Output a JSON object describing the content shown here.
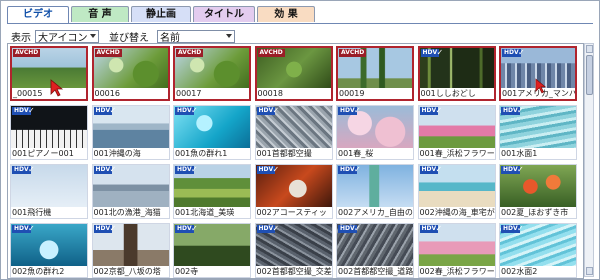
{
  "tabs": [
    {
      "label": "ビデオ",
      "active": true
    },
    {
      "label": "音 声",
      "active": false
    },
    {
      "label": "静止画",
      "active": false
    },
    {
      "label": "タイトル",
      "active": false
    },
    {
      "label": "効 果",
      "active": false
    }
  ],
  "toolbar": {
    "display_label": "表示",
    "display_value": "大アイコン",
    "sort_label": "並び替え",
    "sort_value": "名前"
  },
  "clips": [
    {
      "name": "_00015",
      "badge": "AVCHD",
      "selected": true,
      "scene": "tree-field"
    },
    {
      "name": "00016",
      "badge": "AVCHD",
      "selected": true,
      "scene": "leaves"
    },
    {
      "name": "00017",
      "badge": "AVCHD",
      "selected": true,
      "scene": "leaves"
    },
    {
      "name": "00018",
      "badge": "AVCHD",
      "selected": true,
      "scene": "leaves-dark"
    },
    {
      "name": "00019",
      "badge": "AVCHD",
      "selected": true,
      "scene": "poplars"
    },
    {
      "name": "001ししおどし",
      "badge": "HDV",
      "selected": true,
      "scene": "bamboo"
    },
    {
      "name": "001アメリカ_マンハ",
      "badge": "HDV",
      "selected": true,
      "scene": "skyline"
    },
    {
      "name": "001ピアノー001",
      "badge": "HDV",
      "selected": false,
      "scene": "piano"
    },
    {
      "name": "001沖縄の海",
      "badge": "HDV",
      "selected": false,
      "scene": "ocean"
    },
    {
      "name": "001魚の群れ1",
      "badge": "HDV",
      "selected": false,
      "scene": "cyan"
    },
    {
      "name": "001首都都空撮",
      "badge": "HDV",
      "selected": false,
      "scene": "city"
    },
    {
      "name": "001春_桜",
      "badge": "HDV",
      "selected": false,
      "scene": "sakura"
    },
    {
      "name": "001春_浜松フラワー",
      "badge": "HDV",
      "selected": false,
      "scene": "flowers"
    },
    {
      "name": "001水面1",
      "badge": "HDV",
      "selected": false,
      "scene": "water"
    },
    {
      "name": "001飛行機",
      "badge": "HDV",
      "selected": false,
      "scene": "sky"
    },
    {
      "name": "001北の漁港_海猫",
      "badge": "HDV",
      "selected": false,
      "scene": "harbor"
    },
    {
      "name": "001北海道_美瑛",
      "badge": "HDV",
      "selected": false,
      "scene": "fields"
    },
    {
      "name": "002アコースティッ",
      "badge": "HDV",
      "selected": false,
      "scene": "guitar"
    },
    {
      "name": "002アメリカ_自由の",
      "badge": "HDV",
      "selected": false,
      "scene": "liberty"
    },
    {
      "name": "002沖縄の海_車宅が",
      "badge": "HDV",
      "selected": false,
      "scene": "beach"
    },
    {
      "name": "002夏_ほおずき市",
      "badge": "HDV",
      "selected": false,
      "scene": "lanterns"
    },
    {
      "name": "002魚の群れ2",
      "badge": "HDV",
      "selected": false,
      "scene": "fish"
    },
    {
      "name": "002京都_八坂の塔",
      "badge": "HDV",
      "selected": false,
      "scene": "pagoda"
    },
    {
      "name": "002寺",
      "badge": "HDV",
      "selected": false,
      "scene": "temple"
    },
    {
      "name": "002首都都空撮_交差",
      "badge": "HDV",
      "selected": false,
      "scene": "city2"
    },
    {
      "name": "002首都都空撮_道路",
      "badge": "HDV",
      "selected": false,
      "scene": "city3"
    },
    {
      "name": "002春_浜松フラワー",
      "badge": "HDV",
      "selected": false,
      "scene": "flowers2"
    },
    {
      "name": "002水面2",
      "badge": "HDV",
      "selected": false,
      "scene": "water2"
    }
  ]
}
